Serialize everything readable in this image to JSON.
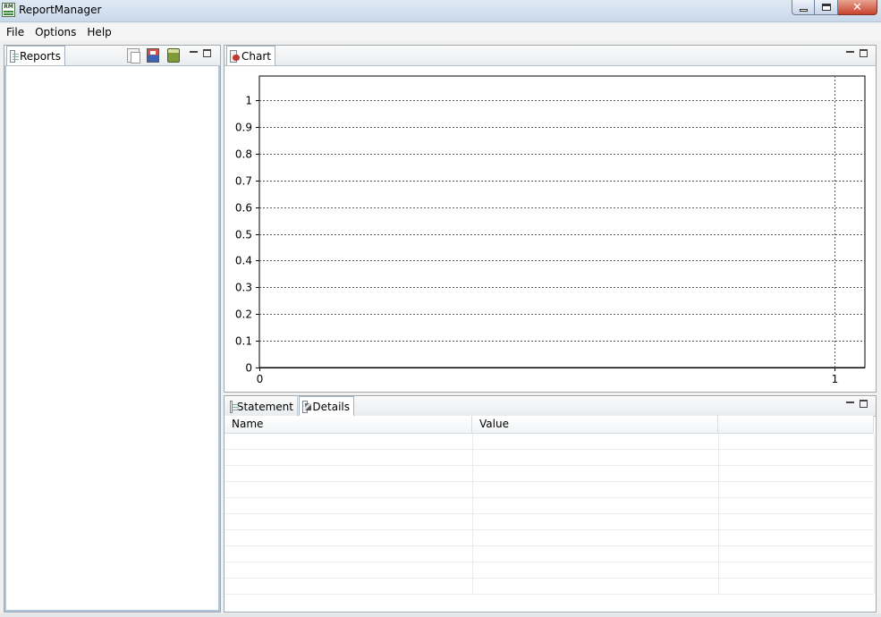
{
  "window": {
    "title": "ReportManager",
    "icon_text": "RM"
  },
  "menu": [
    "File",
    "Options",
    "Help"
  ],
  "reports_panel": {
    "tab_label": "Reports",
    "toolbar_icons": [
      "copy-icon",
      "save-icon",
      "archive-icon"
    ]
  },
  "chart_panel": {
    "tab_label": "Chart"
  },
  "details_panel": {
    "tabs": [
      {
        "label": "Statement",
        "icon": "statement-icon",
        "active": false
      },
      {
        "label": "Details",
        "icon": "details-icon",
        "active": true
      }
    ],
    "columns": [
      "Name",
      "Value",
      ""
    ],
    "rows": [
      [
        "",
        "",
        ""
      ],
      [
        "",
        "",
        ""
      ],
      [
        "",
        "",
        ""
      ],
      [
        "",
        "",
        ""
      ],
      [
        "",
        "",
        ""
      ],
      [
        "",
        "",
        ""
      ],
      [
        "",
        "",
        ""
      ],
      [
        "",
        "",
        ""
      ],
      [
        "",
        "",
        ""
      ],
      [
        "",
        "",
        ""
      ]
    ]
  },
  "chart_data": {
    "type": "line",
    "title": "",
    "xlabel": "",
    "ylabel": "",
    "xlim": [
      0,
      1
    ],
    "ylim": [
      0,
      1
    ],
    "x_ticks": [
      "0",
      "1"
    ],
    "y_ticks": [
      "0",
      "0.1",
      "0.2",
      "0.3",
      "0.4",
      "0.5",
      "0.6",
      "0.7",
      "0.8",
      "0.9",
      "1"
    ],
    "grid": true,
    "series": []
  },
  "colors": {
    "title_bar": "#c9d8ea",
    "close_button": "#c7432b",
    "grid_line": "#555555"
  }
}
